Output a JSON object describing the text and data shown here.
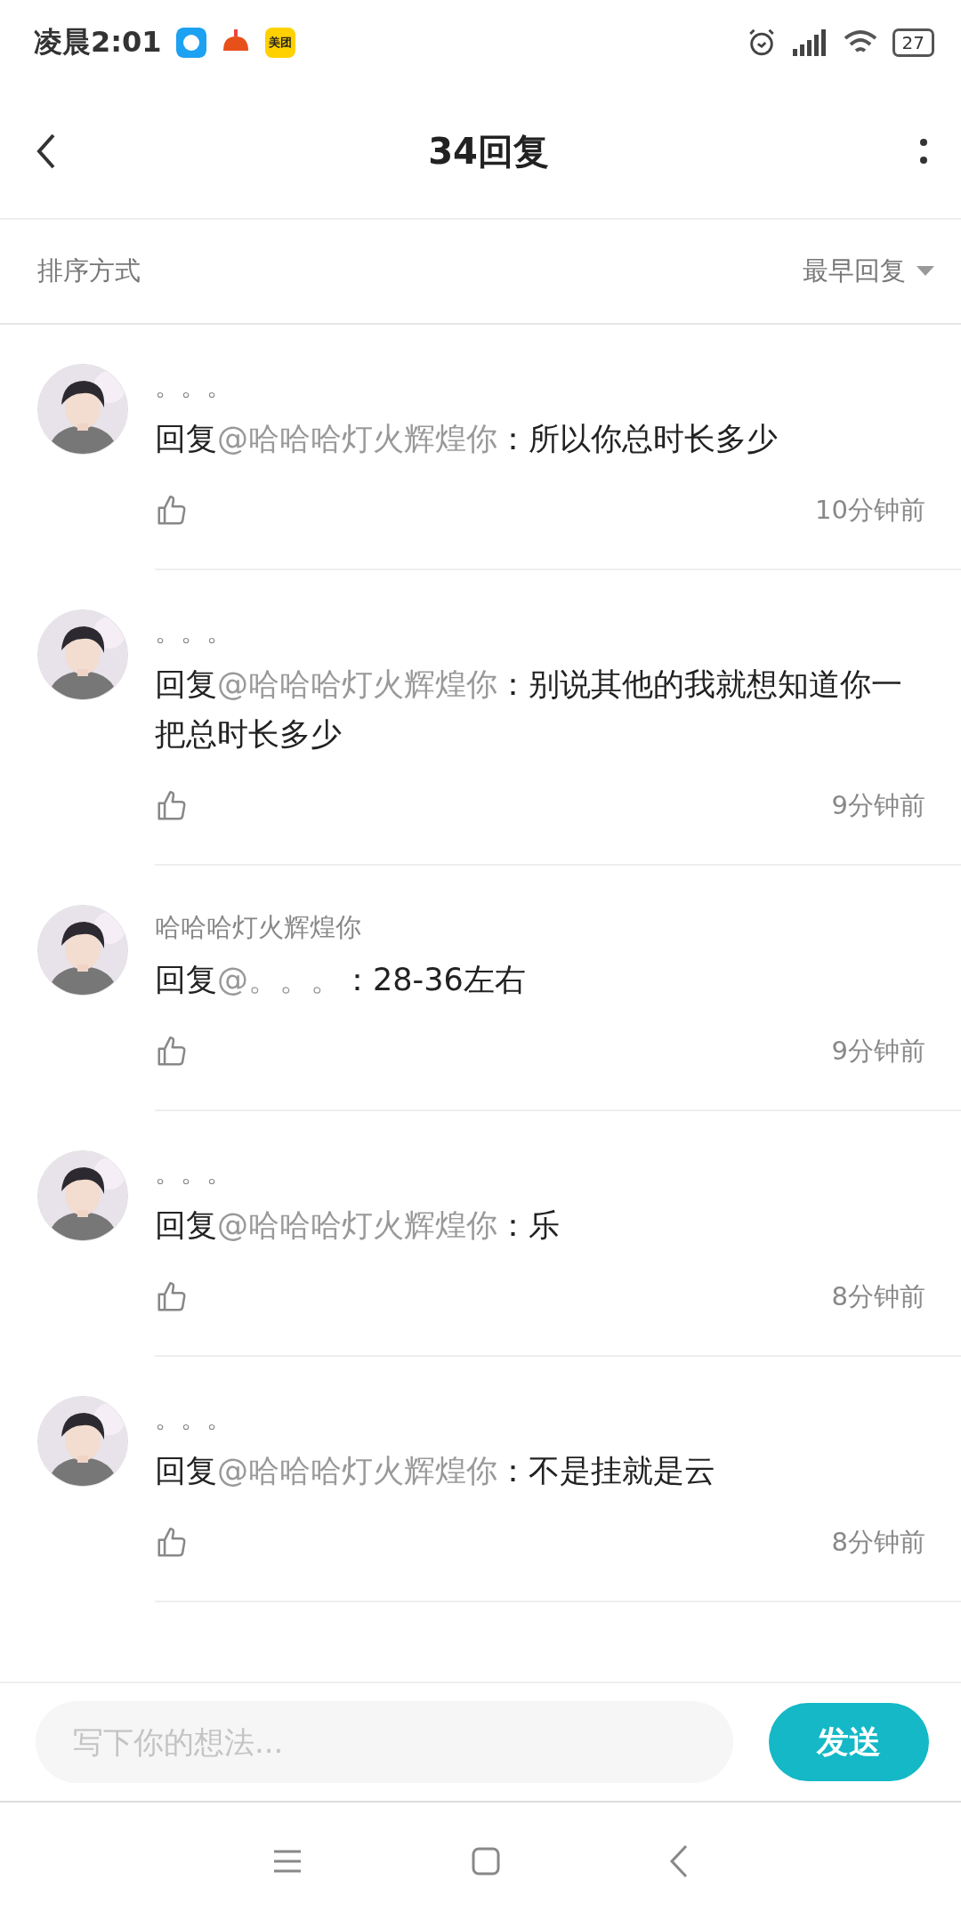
{
  "status_bar": {
    "time": "凌晨2:01",
    "app_badge": "美团",
    "battery": "27"
  },
  "header": {
    "title": "34回复"
  },
  "sort": {
    "label": "排序方式",
    "value": "最早回复"
  },
  "replies": [
    {
      "name": "。。。",
      "prefix": "回复",
      "mention": "@哈哈哈灯火辉煌你",
      "text": "：所以你总时长多少",
      "time": "10分钟前"
    },
    {
      "name": "。。。",
      "prefix": "回复",
      "mention": "@哈哈哈灯火辉煌你",
      "text": "：别说其他的我就想知道你一把总时长多少",
      "time": "9分钟前"
    },
    {
      "name": "哈哈哈灯火辉煌你",
      "prefix": "回复",
      "mention": "@。。。",
      "text": "：28-36左右",
      "time": "9分钟前"
    },
    {
      "name": "。。。",
      "prefix": "回复",
      "mention": "@哈哈哈灯火辉煌你",
      "text": "：乐",
      "time": "8分钟前"
    },
    {
      "name": "。。。",
      "prefix": "回复",
      "mention": "@哈哈哈灯火辉煌你",
      "text": "：不是挂就是云",
      "time": "8分钟前"
    }
  ],
  "composer": {
    "placeholder": "写下你的想法...",
    "send": "发送"
  }
}
